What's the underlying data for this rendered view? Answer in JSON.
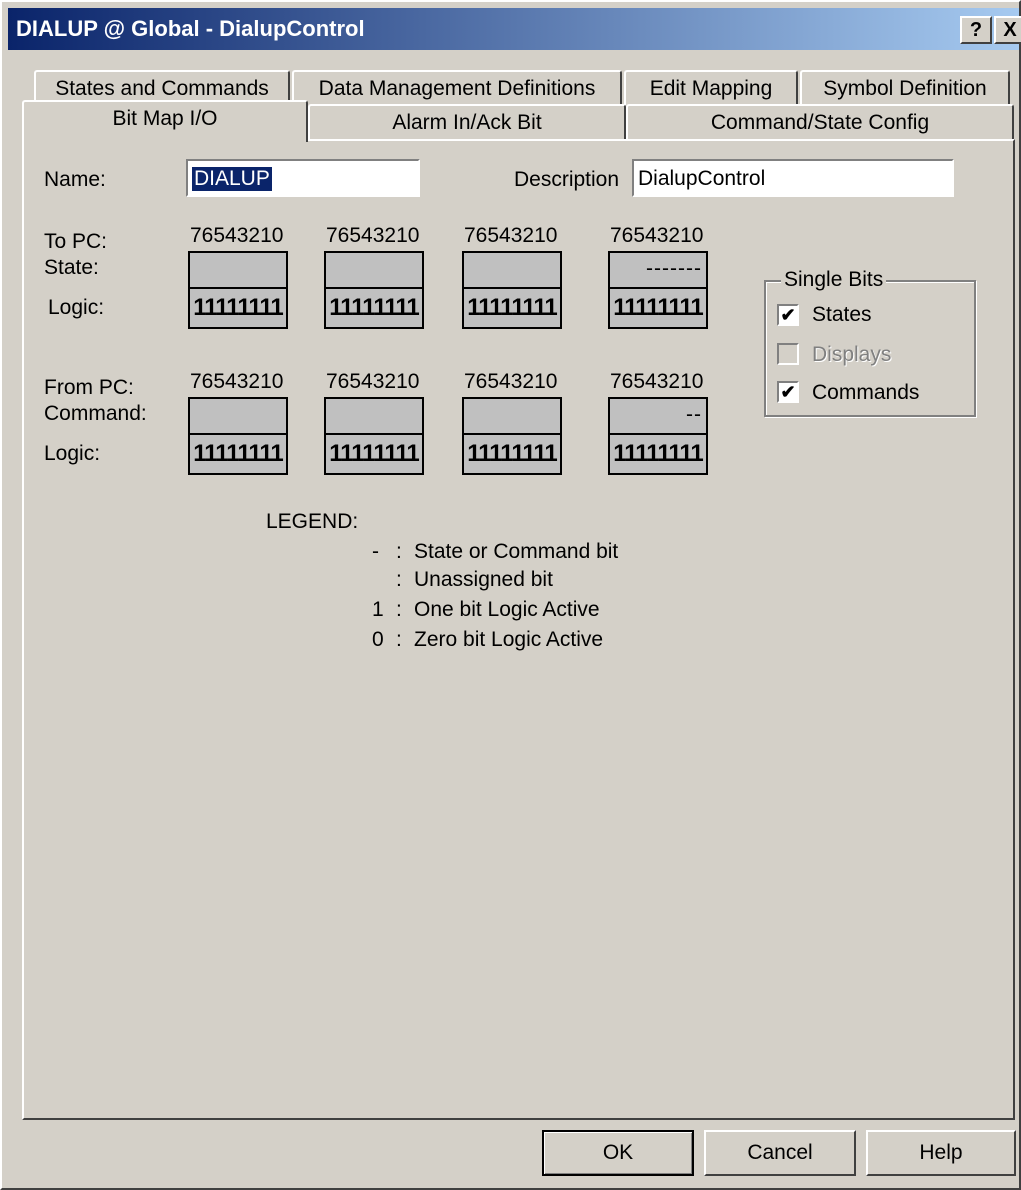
{
  "window": {
    "title": "DIALUP @ Global - DialupControl",
    "help_button": "?",
    "close_button": "X"
  },
  "tabs": {
    "row1": [
      "States and Commands",
      "Data Management Definitions",
      "Edit Mapping",
      "Symbol Definition"
    ],
    "row2": [
      "Bit Map I/O",
      "Alarm In/Ack Bit",
      "Command/State Config"
    ],
    "active": "Bit Map I/O"
  },
  "form": {
    "name_label": "Name:",
    "name_value": "DIALUP",
    "description_label": "Description",
    "description_value": "DialupControl"
  },
  "to_pc": {
    "label": "To PC:",
    "sub_label": "State:",
    "logic_label": "Logic:",
    "bit_headers": [
      "76543210",
      "76543210",
      "76543210",
      "76543210"
    ],
    "state_values": [
      "",
      "",
      "",
      "-------"
    ],
    "logic_values": [
      "11111111",
      "11111111",
      "11111111",
      "11111111"
    ]
  },
  "from_pc": {
    "label": "From PC:",
    "sub_label": "Command:",
    "logic_label": "Logic:",
    "bit_headers": [
      "76543210",
      "76543210",
      "76543210",
      "76543210"
    ],
    "command_values": [
      "",
      "",
      "",
      "--"
    ],
    "logic_values": [
      "11111111",
      "11111111",
      "11111111",
      "11111111"
    ]
  },
  "single_bits": {
    "title": "Single Bits",
    "items": [
      {
        "label": "States",
        "checked": "✔",
        "enabled": true
      },
      {
        "label": "Displays",
        "checked": "",
        "enabled": false
      },
      {
        "label": "Commands",
        "checked": "✔",
        "enabled": true
      }
    ]
  },
  "legend": {
    "title": "LEGEND:",
    "items": [
      {
        "symbol": "-",
        "desc": "State or Command bit"
      },
      {
        "symbol": "",
        "desc": "Unassigned bit"
      },
      {
        "symbol": "1",
        "desc": "One bit Logic Active"
      },
      {
        "symbol": "0",
        "desc": "Zero bit Logic Active"
      }
    ]
  },
  "buttons": {
    "ok": "OK",
    "cancel": "Cancel",
    "help": "Help"
  },
  "colors": {
    "title_start": "#0a246a",
    "title_end": "#a6caf0",
    "face": "#d4d0c8",
    "selection": "#0a246a"
  }
}
